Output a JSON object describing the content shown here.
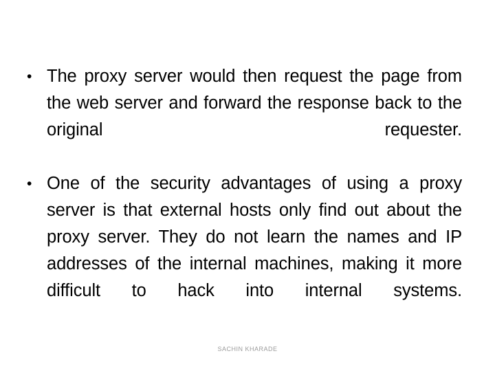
{
  "slide": {
    "background_color": "#ffffff",
    "text_color": "#000000",
    "bullets": [
      {
        "marker": "•",
        "text": "The proxy server would then request the page from the web server and forward the response back to the original requester."
      },
      {
        "marker": "•",
        "text_before_pair": "One of the",
        "nowrap_pair": "security advantages",
        "text_after_pair": "of using a proxy server is that external hosts only find out about the proxy server. They do not learn the names and IP addresses of the internal machines, making it more difficult to hack into internal systems."
      }
    ]
  },
  "footer": {
    "credit": "SACHIN KHARADE",
    "color": "#9a9a9a"
  }
}
